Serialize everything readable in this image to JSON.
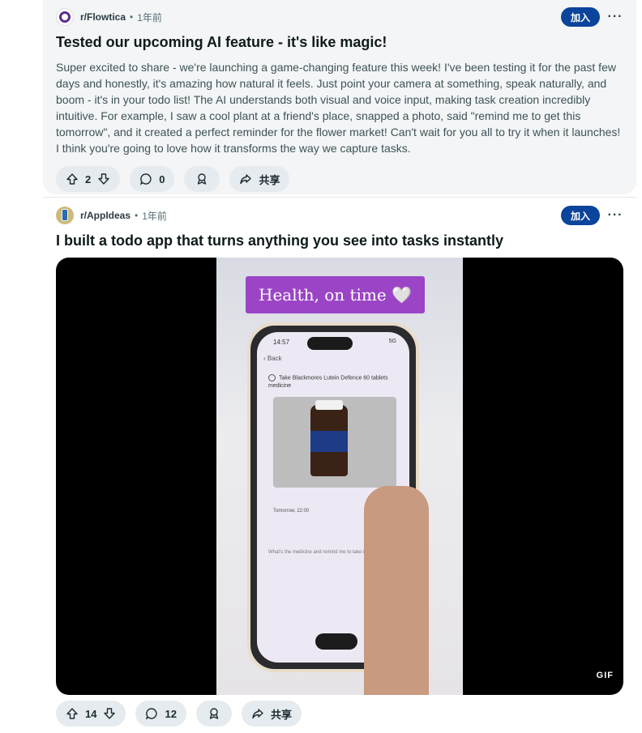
{
  "posts": [
    {
      "subreddit": "r/Flowtica",
      "time": "1年前",
      "join_label": "加入",
      "more_label": "···",
      "title": "Tested our upcoming AI feature - it's like magic!",
      "body": "Super excited to share - we're launching a game-changing feature this week! I've been testing it for the past few days and honestly, it's amazing how natural it feels. Just point your camera at something, speak naturally, and boom - it's in your todo list! The AI understands both visual and voice input, making task creation incredibly intuitive. For example, I saw a cool plant at a friend's place, snapped a photo, said \"remind me to get this tomorrow\", and it created a perfect reminder for the flower market! Can't wait for you all to try it when it launches! I think you're going to love how it transforms the way we capture tasks.",
      "votes": "2",
      "comments": "0",
      "share_label": "共享"
    },
    {
      "subreddit": "r/AppIdeas",
      "time": "1年前",
      "join_label": "加入",
      "more_label": "···",
      "title": "I built a todo app that turns anything you see into tasks instantly",
      "media": {
        "caption": "Health, on time 🤍",
        "phone_time": "14:57",
        "phone_status": "5G",
        "back_label": "Back",
        "task_text": "Take Blackmores Lutein Defence 60 tablets medicine",
        "reminder": "Tomorrow, 22:00",
        "chat_text": "What's the medicine and remind me to take it tomorrow 10 PM",
        "badge": "GIF"
      },
      "votes": "14",
      "comments": "12",
      "share_label": "共享"
    }
  ],
  "icons": [
    "upvote-icon",
    "downvote-icon",
    "comment-icon",
    "award-icon",
    "share-icon",
    "more-icon"
  ],
  "colors": {
    "join_button": "#0a449b",
    "pill_bg": "#e5ebee",
    "caption_bg": "#9b45c6"
  }
}
